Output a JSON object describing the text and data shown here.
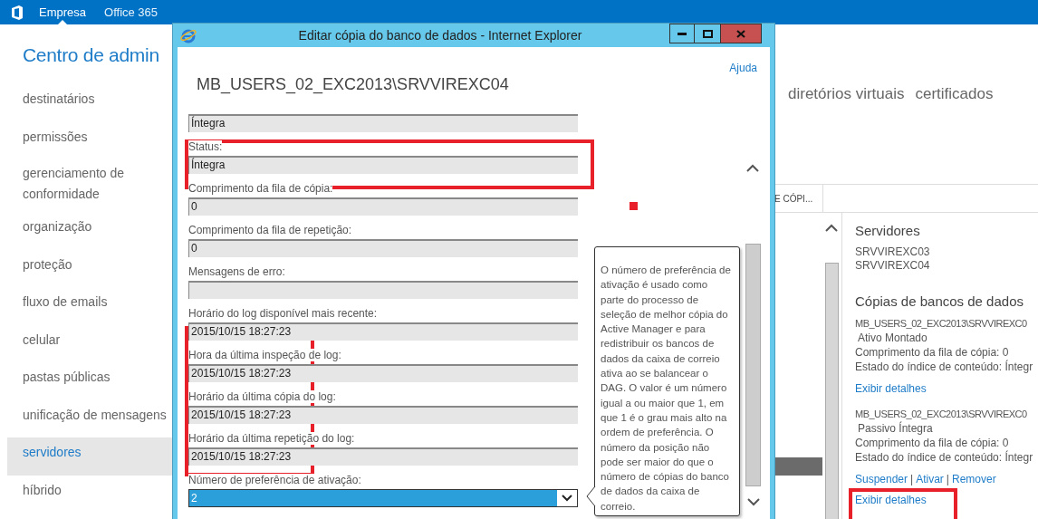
{
  "top_bar": {
    "items": [
      {
        "label": "Empresa",
        "selected": true
      },
      {
        "label": "Office 365",
        "selected": false
      }
    ]
  },
  "admin_title": "Centro de admin",
  "sidebar": {
    "items": [
      {
        "label": "destinatários",
        "selected": false
      },
      {
        "label": "permissões",
        "selected": false
      },
      {
        "label": "gerenciamento de conformidade",
        "selected": false
      },
      {
        "label": "organização",
        "selected": false
      },
      {
        "label": "proteção",
        "selected": false
      },
      {
        "label": "fluxo de emails",
        "selected": false
      },
      {
        "label": "celular",
        "selected": false
      },
      {
        "label": "pastas públicas",
        "selected": false
      },
      {
        "label": "unificação de mensagens",
        "selected": false
      },
      {
        "label": "servidores",
        "selected": true
      },
      {
        "label": "híbrido",
        "selected": false
      }
    ]
  },
  "tabs": [
    "diretórios virtuais",
    "certificados"
  ],
  "list": {
    "column_header": "E CÓPI..."
  },
  "details": {
    "servers_title": "Servidores",
    "servers": [
      "SRVVIREXC03",
      "SRVVIREXC04"
    ],
    "copies_title": "Cópias de bancos de dados",
    "copies": [
      {
        "name": "MB_USERS_02_EXC2013\\SRVVIREXC0",
        "status": "Ativo Montado",
        "lines": [
          "Comprimento da fila de cópia: 0",
          "Estado do índice de conteúdo: Íntegr"
        ],
        "details_link": "Exibir detalhes"
      },
      {
        "name": "MB_USERS_02_EXC2013\\SRVVIREXC0",
        "status": "Passivo Íntegra",
        "lines": [
          "Comprimento da fila de cópia: 0",
          "Estado do índice de conteúdo: Íntegr"
        ],
        "actions": [
          "Suspender",
          "Ativar",
          "Remover"
        ],
        "details_link": "Exibir detalhes"
      }
    ],
    "separator": "|"
  },
  "dialog": {
    "title": "Editar cópia do banco de dados - Internet Explorer",
    "help": "Ajuda",
    "heading": "MB_USERS_02_EXC2013\\SRVVIREXC04",
    "fields": [
      {
        "kind": "text",
        "value": "Íntegra"
      },
      {
        "kind": "text",
        "label": "Status:",
        "value": "Íntegra"
      },
      {
        "kind": "text",
        "label": "Comprimento da fila de cópia:",
        "value": "0"
      },
      {
        "kind": "text",
        "label": "Comprimento da fila de repetição:",
        "value": "0"
      },
      {
        "kind": "text",
        "label": "Mensagens de erro:"
      },
      {
        "kind": "text",
        "label": "Horário do log disponível mais recente:",
        "value": "2015/10/15 18:27:23"
      },
      {
        "kind": "text",
        "label": "Hora da última inspeção de log:",
        "value": "2015/10/15 18:27:23"
      },
      {
        "kind": "text",
        "label": "Horário da última cópia do log:",
        "value": "2015/10/15 18:27:23"
      },
      {
        "kind": "text",
        "label": "Horário da última repetição do log:",
        "value": "2015/10/15 18:27:23"
      },
      {
        "kind": "select",
        "label": "Número de preferência de ativação:",
        "value": "2"
      }
    ],
    "tooltip": "O número de preferência de ativação é usado como parte do processo de seleção de melhor cópia do Active Manager e para redistribuir os bancos de dados da caixa de correio ativa ao se balancear o DAG. O valor é um número igual a ou maior que 1, em que 1 é o grau mais alto na ordem de preferência. O número da posição não pode ser maior do que o número de cópias do banco de dados da caixa de correio."
  }
}
